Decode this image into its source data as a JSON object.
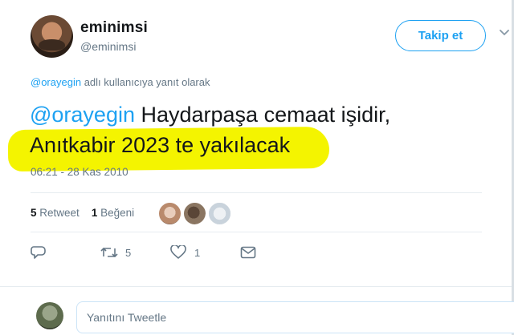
{
  "header": {
    "display_name": "eminimsi",
    "handle": "@eminimsi",
    "follow_label": "Takip et"
  },
  "tweet": {
    "reply_context_mention": "@orayegin",
    "reply_context_text": " adlı kullanıcıya yanıt olarak",
    "mention": "@orayegin",
    "line1_rest": " Haydarpaşa cemaat işidir,",
    "line2": "Anıtkabir 2023 te yakılacak",
    "timestamp": "06:21 - 28 Kas 2010",
    "highlight_color": "#f4f400"
  },
  "stats": {
    "retweet_count": "5",
    "retweet_label": " Retweet",
    "like_count": "1",
    "like_label": " Beğeni"
  },
  "actions": {
    "retweet_count": "5",
    "like_count": "1"
  },
  "reply_box": {
    "placeholder": "Yanıtını Tweetle"
  },
  "colors": {
    "accent": "#1da1f2",
    "secondary_text": "#657786"
  }
}
